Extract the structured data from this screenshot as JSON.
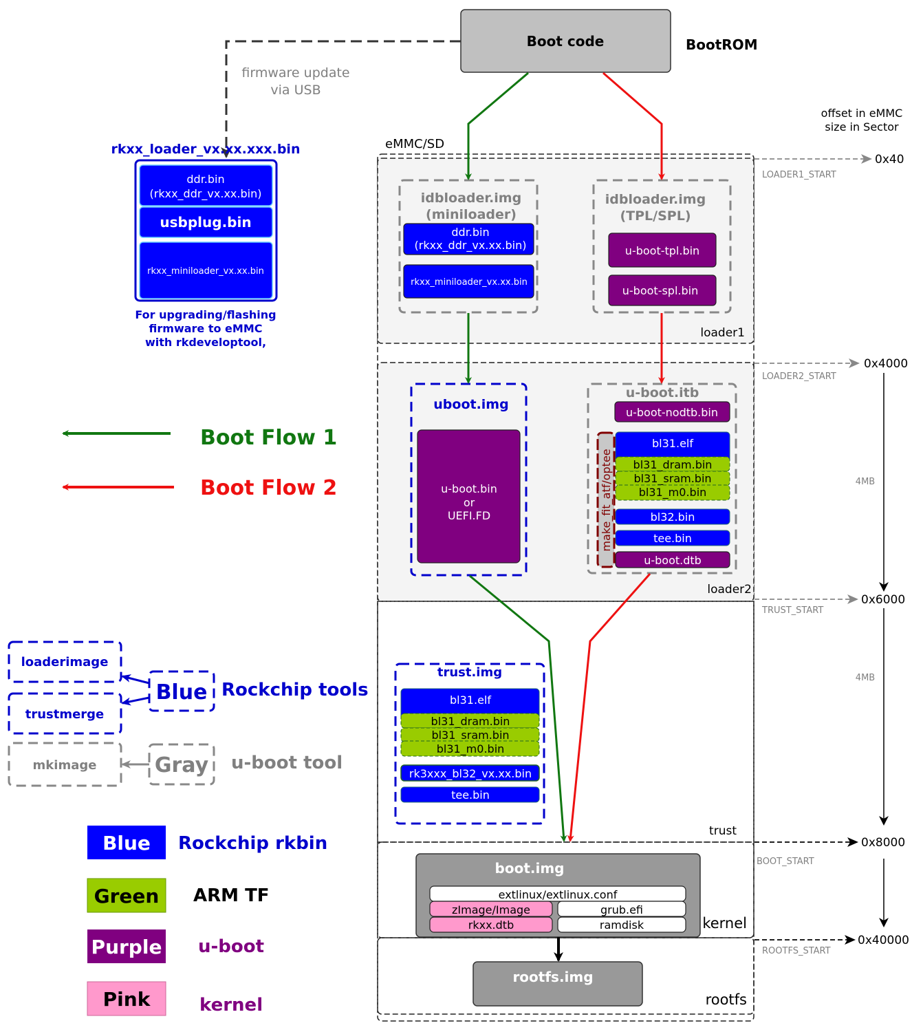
{
  "colors": {
    "rkbin_blue": "#0000ff",
    "armtf_green": "#99cc00",
    "uboot_purple": "#800080",
    "kernel_pink": "#ff99cc",
    "flow1_green": "#117711",
    "flow2_red": "#ee1111",
    "region_fill": "#f4f4f4",
    "image_gray": "#999999"
  },
  "bootrom": {
    "box_label": "Boot code",
    "side_label": "BootROM"
  },
  "usb_update": {
    "label_line1": "firmware update",
    "label_line2": "via USB"
  },
  "rkxx_loader": {
    "title": "rkxx_loader_vx.xx.xxx.bin",
    "items": [
      {
        "line1": "ddr.bin",
        "line2": "(rkxx_ddr_vx.xx.bin)"
      },
      {
        "line1": "usbplug.bin"
      },
      {
        "line1": "rkxx_miniloader_vx.xx.bin"
      }
    ],
    "caption": [
      "For upgrading/flashing",
      "firmware to eMMC",
      "with rkdeveloptool,"
    ]
  },
  "offset_header": {
    "line1": "offset in eMMC",
    "line2": "size in Sector"
  },
  "emmc_label": "eMMC/SD",
  "regions": [
    {
      "name": "loader1",
      "start_label": "LOADER1_START",
      "offset": "0x40"
    },
    {
      "name": "loader2",
      "start_label": "LOADER2_START",
      "offset": "0x4000"
    },
    {
      "name": "trust",
      "start_label": "TRUST_START",
      "offset": "0x6000"
    },
    {
      "name": "kernel",
      "start_label": "BOOT_START",
      "offset": "0x8000"
    },
    {
      "name": "rootfs",
      "start_label": "ROOTFS_START",
      "offset": "0x40000"
    }
  ],
  "sizes": [
    "4MB",
    "4MB"
  ],
  "idb_mini": {
    "title1": "idbloader.img",
    "title2": "(miniloader)",
    "items": [
      {
        "line1": "ddr.bin",
        "line2": "(rkxx_ddr_vx.xx.bin)"
      },
      {
        "line1": "rkxx_miniloader_vx.xx.bin"
      }
    ]
  },
  "idb_spl": {
    "title1": "idbloader.img",
    "title2": "(TPL/SPL)",
    "items": [
      "u-boot-tpl.bin",
      "u-boot-spl.bin"
    ]
  },
  "uboot_img": {
    "title": "uboot.img",
    "content": [
      "u-boot.bin",
      "or",
      "UEFI.FD"
    ]
  },
  "uboot_itb": {
    "title": "u-boot.itb",
    "nodtb": "u-boot-nodtb.bin",
    "make_fit": "make_fit_atf/optee",
    "bl31_elf": "bl31.elf",
    "bl31_parts": [
      "bl31_dram.bin",
      "bl31_sram.bin",
      "bl31_m0.bin"
    ],
    "bl32": "bl32.bin",
    "tee": "tee.bin",
    "dtb": "u-boot.dtb"
  },
  "trust_img": {
    "title": "trust.img",
    "bl31_elf": "bl31.elf",
    "bl31_parts": [
      "bl31_dram.bin",
      "bl31_sram.bin",
      "bl31_m0.bin"
    ],
    "bl32": "rk3xxx_bl32_vx.xx.bin",
    "tee": "tee.bin"
  },
  "boot_img": {
    "title": "boot.img",
    "extlinux": "extlinux/extlinux.conf",
    "zimage": "zImage/Image",
    "dtb": "rkxx.dtb",
    "grub": "grub.efi",
    "ramdisk": "ramdisk"
  },
  "rootfs_img": {
    "title": "rootfs.img"
  },
  "flow_legend": [
    {
      "label": "Boot Flow 1",
      "color": "#117711"
    },
    {
      "label": "Boot Flow 2",
      "color": "#ee1111"
    }
  ],
  "tools_legend": {
    "blue_tag": "Blue",
    "blue_desc": "Rockchip tools",
    "blue_tools": [
      "loaderimage",
      "trustmerge"
    ],
    "gray_tag": "Gray",
    "gray_desc": "u-boot tool",
    "gray_tools": [
      "mkimage"
    ]
  },
  "color_legend": [
    {
      "swatch": "Blue",
      "desc": "Rockchip rkbin"
    },
    {
      "swatch": "Green",
      "desc": "ARM TF"
    },
    {
      "swatch": "Purple",
      "desc": "u-boot"
    },
    {
      "swatch": "Pink",
      "desc": "kernel"
    }
  ]
}
